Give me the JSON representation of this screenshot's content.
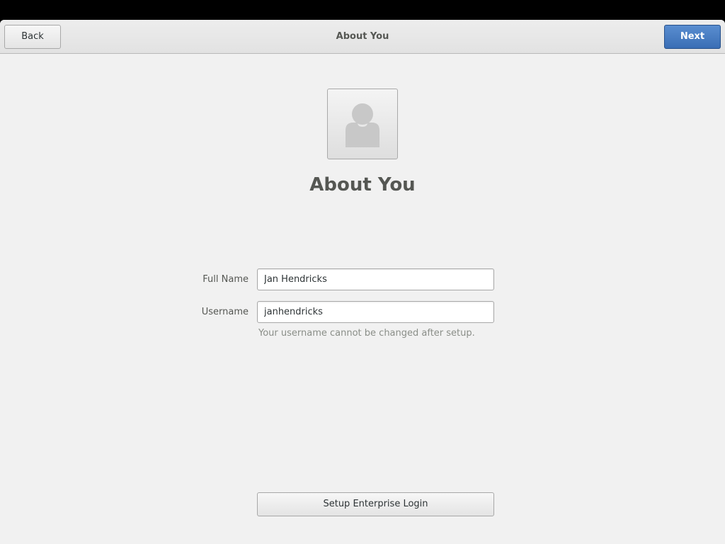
{
  "headerbar": {
    "title": "About You",
    "back_label": "Back",
    "next_label": "Next"
  },
  "main": {
    "avatar_icon": "user-avatar-icon",
    "heading": "About You",
    "fullname": {
      "label": "Full Name",
      "value": "Jan Hendricks"
    },
    "username": {
      "label": "Username",
      "value": "janhendricks",
      "hint": "Your username cannot be changed after setup."
    },
    "enterprise_button_label": "Setup Enterprise Login"
  },
  "colors": {
    "background": "#f1f1f1",
    "accent": "#3a6eb5",
    "text": "#555753"
  }
}
